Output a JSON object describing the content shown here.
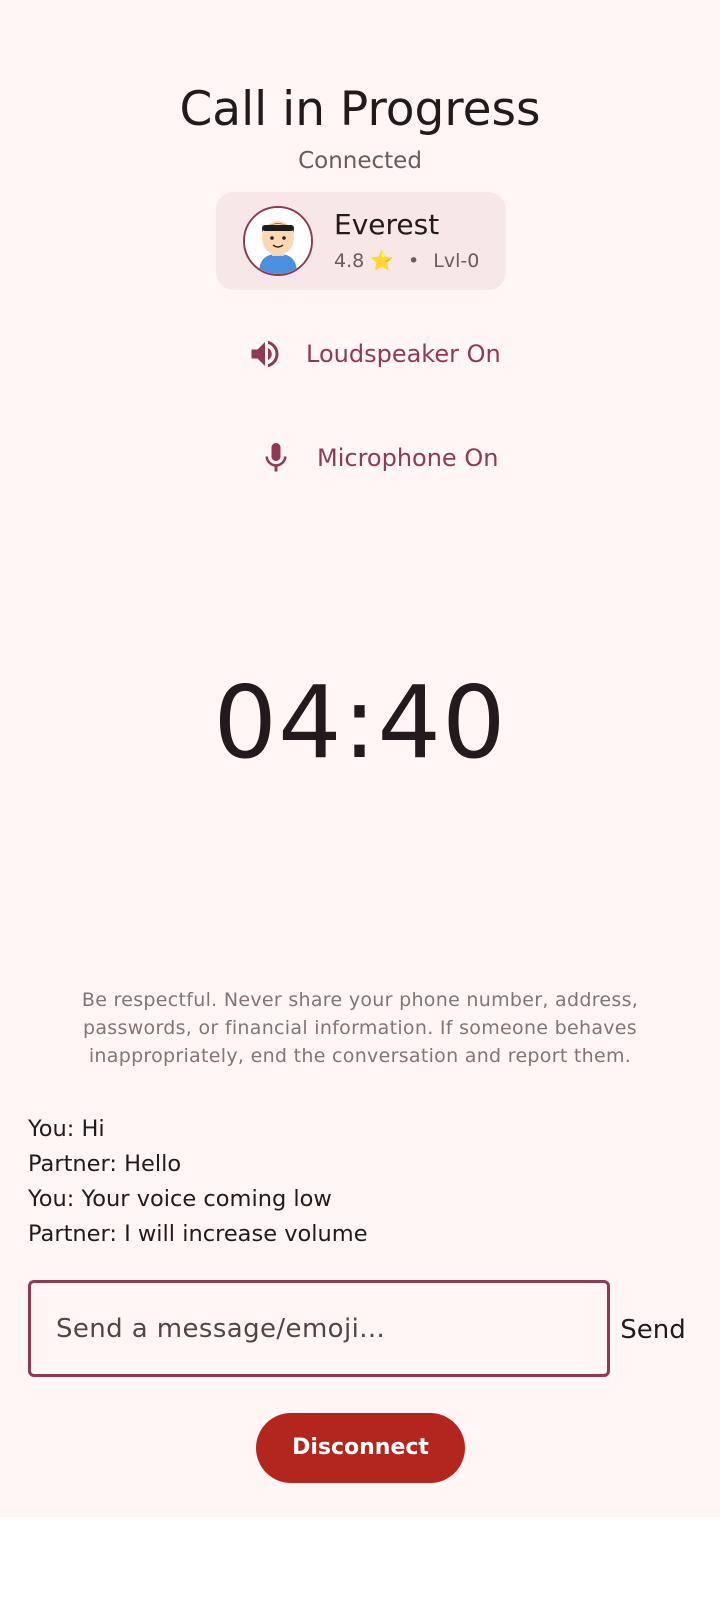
{
  "header": {
    "title": "Call in Progress",
    "status": "Connected"
  },
  "partner": {
    "name": "Everest",
    "rating": "4.8",
    "rating_icon": "⭐",
    "separator": "•",
    "level": "Lvl-0",
    "avatar_icon": "user-avatar-icon"
  },
  "controls": {
    "loudspeaker": {
      "label": "Loudspeaker On",
      "icon": "speaker-icon"
    },
    "microphone": {
      "label": "Microphone On",
      "icon": "microphone-icon"
    }
  },
  "timer": "04:40",
  "safety_notice": "Be respectful. Never share your phone number, address, passwords, or financial information. If someone behaves inappropriately, end the conversation and report them.",
  "chat": [
    "You: Hi",
    "Partner: Hello",
    "You: Your voice coming low",
    "Partner: I will increase volume"
  ],
  "composer": {
    "placeholder": "Send a message/emoji...",
    "value": "",
    "send_label": "Send"
  },
  "disconnect_label": "Disconnect",
  "colors": {
    "background": "#fff6f5",
    "accent": "#8e3b52",
    "card": "#f8e7e7",
    "danger": "#b3261e"
  }
}
